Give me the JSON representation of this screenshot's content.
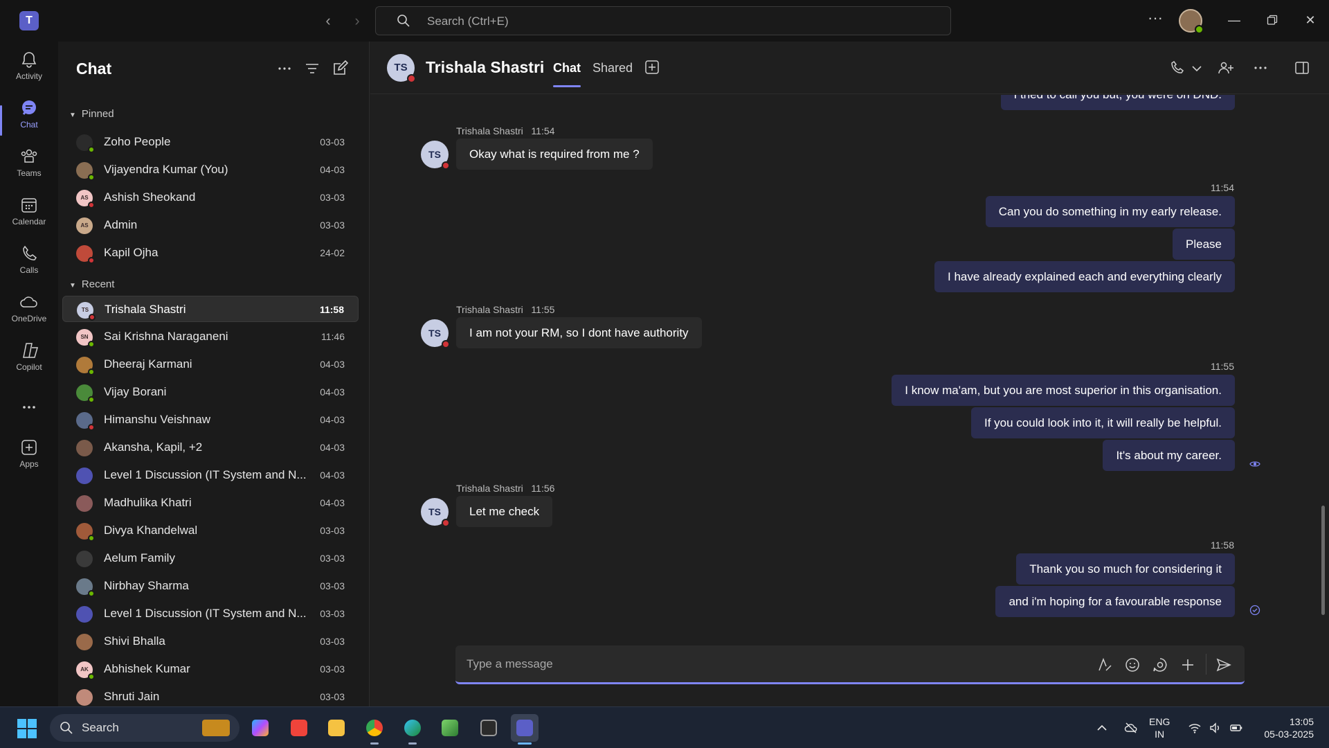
{
  "titlebar": {
    "logo_text": "T",
    "search_placeholder": "Search (Ctrl+E)",
    "more": "···"
  },
  "rail": [
    {
      "label": "Activity",
      "icon": "bell-icon"
    },
    {
      "label": "Chat",
      "icon": "chat-icon",
      "active": true
    },
    {
      "label": "Teams",
      "icon": "teams-icon"
    },
    {
      "label": "Calendar",
      "icon": "calendar-icon"
    },
    {
      "label": "Calls",
      "icon": "phone-icon"
    },
    {
      "label": "OneDrive",
      "icon": "cloud-icon"
    },
    {
      "label": "Copilot",
      "icon": "copilot-icon"
    },
    {
      "label": "",
      "icon": "more-icon"
    },
    {
      "label": "Apps",
      "icon": "apps-icon"
    }
  ],
  "list": {
    "title": "Chat",
    "pinned_label": "Pinned",
    "recent_label": "Recent",
    "pinned": [
      {
        "name": "Zoho People",
        "date": "03-03",
        "initials": "",
        "color": "#2b2b2b",
        "status": "#6bb700"
      },
      {
        "name": "Vijayendra Kumar (You)",
        "date": "04-03",
        "initials": "",
        "color": "#8a6e53",
        "status": "#6bb700"
      },
      {
        "name": "Ashish Sheokand",
        "date": "03-03",
        "initials": "AS",
        "color": "#f1c5c5",
        "status": "#d13438"
      },
      {
        "name": "Admin",
        "date": "03-03",
        "initials": "AS",
        "color": "#c9a98a",
        "status": ""
      },
      {
        "name": "Kapil Ojha",
        "date": "24-02",
        "initials": "",
        "color": "#c04a3a",
        "status": "#d13438"
      }
    ],
    "recent": [
      {
        "name": "Trishala Shastri",
        "date": "11:58",
        "initials": "TS",
        "color": "#c7cde3",
        "status": "#d13438",
        "selected": true
      },
      {
        "name": "Sai Krishna Naraganeni",
        "date": "11:46",
        "initials": "SN",
        "color": "#f1c5c5",
        "status": "#6bb700"
      },
      {
        "name": "Dheeraj Karmani",
        "date": "04-03",
        "initials": "",
        "color": "#b07a3a",
        "status": "#6bb700"
      },
      {
        "name": "Vijay Borani",
        "date": "04-03",
        "initials": "",
        "color": "#4a8a3a",
        "status": "#6bb700"
      },
      {
        "name": "Himanshu Veishnaw",
        "date": "04-03",
        "initials": "",
        "color": "#5a6a8a",
        "status": "#d13438"
      },
      {
        "name": "Akansha, Kapil, +2",
        "date": "04-03",
        "initials": "",
        "color": "#7a5a4a",
        "status": ""
      },
      {
        "name": "Level 1 Discussion (IT System and N...",
        "date": "04-03",
        "initials": "",
        "color": "#4f52b2",
        "status": ""
      },
      {
        "name": "Madhulika Khatri",
        "date": "04-03",
        "initials": "",
        "color": "#8a5a5a",
        "status": ""
      },
      {
        "name": "Divya Khandelwal",
        "date": "03-03",
        "initials": "",
        "color": "#a05a3a",
        "status": "#6bb700"
      },
      {
        "name": "Aelum Family",
        "date": "03-03",
        "initials": "",
        "color": "#3a3a3a",
        "status": ""
      },
      {
        "name": "Nirbhay Sharma",
        "date": "03-03",
        "initials": "",
        "color": "#6a7a8a",
        "status": "#6bb700"
      },
      {
        "name": "Level 1 Discussion (IT System and N...",
        "date": "03-03",
        "initials": "",
        "color": "#4f52b2",
        "status": ""
      },
      {
        "name": "Shivi Bhalla",
        "date": "03-03",
        "initials": "",
        "color": "#9a6a4a",
        "status": ""
      },
      {
        "name": "Abhishek Kumar",
        "date": "03-03",
        "initials": "AK",
        "color": "#f1c5c5",
        "status": "#6bb700"
      },
      {
        "name": "Shruti Jain",
        "date": "03-03",
        "initials": "",
        "color": "#c08a7a",
        "status": ""
      }
    ]
  },
  "conversation": {
    "initials": "TS",
    "name": "Trishala Shastri",
    "tabs": [
      "Chat",
      "Shared"
    ],
    "messages": [
      {
        "side": "out",
        "text": "I tried to call you but, you were on DND."
      },
      {
        "side": "in",
        "sender": "Trishala Shastri",
        "time": "11:54",
        "text": "Okay what is required from me ?"
      },
      {
        "side": "out",
        "time": "11:54",
        "text": "Can you do something in my early release."
      },
      {
        "side": "out",
        "text": "Please"
      },
      {
        "side": "out",
        "text": "I have already explained each and everything clearly"
      },
      {
        "side": "in",
        "sender": "Trishala Shastri",
        "time": "11:55",
        "text": "I am not your RM, so I dont have authority"
      },
      {
        "side": "out",
        "time": "11:55",
        "text": "I know ma'am, but you are most superior in this organisation."
      },
      {
        "side": "out",
        "text": "If you could look into it, it will really be helpful."
      },
      {
        "side": "out",
        "text": "It's about my career."
      },
      {
        "side": "in",
        "sender": "Trishala Shastri",
        "time": "11:56",
        "text": "Let me check"
      },
      {
        "side": "out",
        "time": "11:58",
        "text": "Thank you so much for considering it"
      },
      {
        "side": "out",
        "text": "and i'm hoping for a favourable response"
      }
    ]
  },
  "composer": {
    "placeholder": "Type a message"
  },
  "taskbar": {
    "search_label": "Search",
    "lang_line1": "ENG",
    "lang_line2": "IN",
    "time": "13:05",
    "date": "05-03-2025"
  },
  "colors": {
    "accent": "#7f85f5",
    "outgoing_bubble": "#2b2d4f",
    "incoming_bubble": "#2a2a2a",
    "busy": "#d13438",
    "available": "#6bb700"
  }
}
